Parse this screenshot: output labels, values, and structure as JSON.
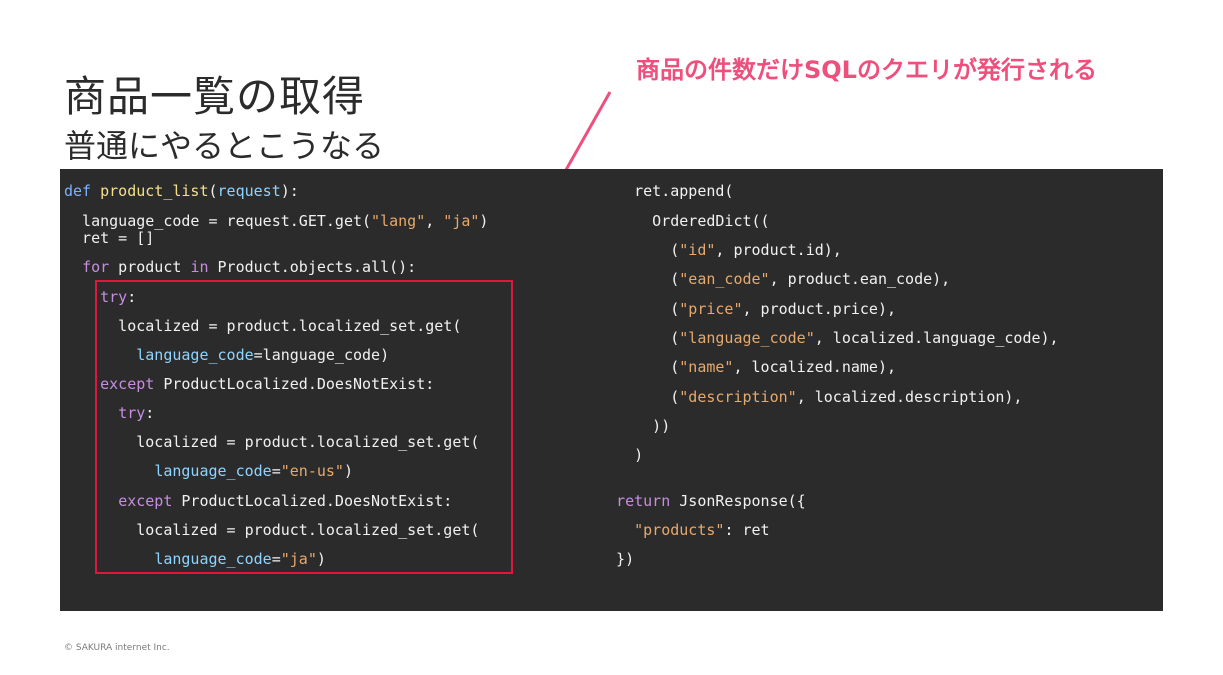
{
  "slide": {
    "title": "商品一覧の取得",
    "subtitle": "普通にやるとこうなる",
    "callout": "商品の件数だけSQLのクエリが発行される",
    "footer": "© SAKURA internet Inc."
  },
  "code": {
    "left": [
      {
        "segments": [
          {
            "t": "def",
            "c": "d"
          },
          {
            "t": " "
          },
          {
            "t": "product_list",
            "c": "f"
          },
          {
            "t": "("
          },
          {
            "t": "request",
            "c": "p"
          },
          {
            "t": "):"
          }
        ]
      },
      {
        "segments": [
          {
            "t": "  language_code = request.GET.get("
          },
          {
            "t": "\"lang\"",
            "c": "s"
          },
          {
            "t": ", "
          },
          {
            "t": "\"ja\"",
            "c": "s"
          },
          {
            "t": ")"
          }
        ]
      },
      {
        "segments": [
          {
            "t": "  ret = []"
          }
        ]
      },
      {
        "segments": [
          {
            "t": "  "
          },
          {
            "t": "for",
            "c": "k"
          },
          {
            "t": " product "
          },
          {
            "t": "in",
            "c": "k"
          },
          {
            "t": " Product.objects.all():"
          }
        ]
      },
      {
        "segments": [
          {
            "t": "    "
          },
          {
            "t": "try",
            "c": "k"
          },
          {
            "t": ":"
          }
        ]
      },
      {
        "segments": [
          {
            "t": "      localized = product.localized_set.get("
          }
        ]
      },
      {
        "segments": [
          {
            "t": "        "
          },
          {
            "t": "language_code",
            "c": "p"
          },
          {
            "t": "=language_code)"
          }
        ]
      },
      {
        "segments": [
          {
            "t": "    "
          },
          {
            "t": "except",
            "c": "k"
          },
          {
            "t": " ProductLocalized.DoesNotExist:"
          }
        ]
      },
      {
        "segments": [
          {
            "t": "      "
          },
          {
            "t": "try",
            "c": "k"
          },
          {
            "t": ":"
          }
        ]
      },
      {
        "segments": [
          {
            "t": "        localized = product.localized_set.get("
          }
        ]
      },
      {
        "segments": [
          {
            "t": "          "
          },
          {
            "t": "language_code",
            "c": "p"
          },
          {
            "t": "="
          },
          {
            "t": "\"en-us\"",
            "c": "s"
          },
          {
            "t": ")"
          }
        ]
      },
      {
        "segments": [
          {
            "t": "      "
          },
          {
            "t": "except",
            "c": "k"
          },
          {
            "t": " ProductLocalized.DoesNotExist:"
          }
        ]
      },
      {
        "segments": [
          {
            "t": "        localized = product.localized_set.get("
          }
        ]
      },
      {
        "segments": [
          {
            "t": "          "
          },
          {
            "t": "language_code",
            "c": "p"
          },
          {
            "t": "="
          },
          {
            "t": "\"ja\"",
            "c": "s"
          },
          {
            "t": ")"
          }
        ]
      }
    ],
    "right": [
      {
        "segments": [
          {
            "t": "    ret.append("
          }
        ]
      },
      {
        "segments": [
          {
            "t": "      OrderedDict(("
          }
        ]
      },
      {
        "segments": [
          {
            "t": "        ("
          },
          {
            "t": "\"id\"",
            "c": "s"
          },
          {
            "t": ", product.id),"
          }
        ]
      },
      {
        "segments": [
          {
            "t": "        ("
          },
          {
            "t": "\"ean_code\"",
            "c": "s"
          },
          {
            "t": ", product.ean_code),"
          }
        ]
      },
      {
        "segments": [
          {
            "t": "        ("
          },
          {
            "t": "\"price\"",
            "c": "s"
          },
          {
            "t": ", product.price),"
          }
        ]
      },
      {
        "segments": [
          {
            "t": "        ("
          },
          {
            "t": "\"language_code\"",
            "c": "s"
          },
          {
            "t": ", localized.language_code),"
          }
        ]
      },
      {
        "segments": [
          {
            "t": "        ("
          },
          {
            "t": "\"name\"",
            "c": "s"
          },
          {
            "t": ", localized.name),"
          }
        ]
      },
      {
        "segments": [
          {
            "t": "        ("
          },
          {
            "t": "\"description\"",
            "c": "s"
          },
          {
            "t": ", localized.description),"
          }
        ]
      },
      {
        "segments": [
          {
            "t": "      ))"
          }
        ]
      },
      {
        "segments": [
          {
            "t": "    )"
          }
        ]
      },
      {
        "segments": [
          {
            "t": "  "
          },
          {
            "t": "return",
            "c": "k"
          },
          {
            "t": " JsonResponse({"
          }
        ]
      },
      {
        "segments": [
          {
            "t": "    "
          },
          {
            "t": "\"products\"",
            "c": "s"
          },
          {
            "t": ": ret"
          }
        ]
      },
      {
        "segments": [
          {
            "t": "  })"
          }
        ]
      }
    ]
  },
  "colors": {
    "callout": "#ef4f7c",
    "highlight_box": "#e0163f",
    "code_background": "#2b2b2b"
  }
}
